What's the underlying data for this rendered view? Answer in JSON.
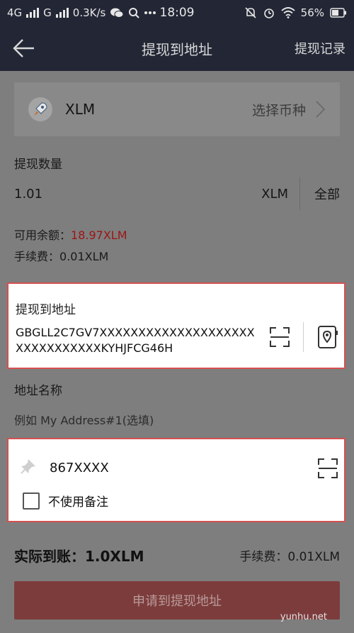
{
  "status_bar": {
    "network_1": "4G",
    "network_2": "G",
    "speed": "0.3K/s",
    "time": "18:09",
    "battery": "56%"
  },
  "nav": {
    "title": "提现到地址",
    "records": "提现记录"
  },
  "coin": {
    "name": "XLM",
    "select_label": "选择币种"
  },
  "amount": {
    "label": "提现数量",
    "value": "1.01",
    "unit": "XLM",
    "all_label": "全部"
  },
  "balance": {
    "label": "可用余额：",
    "value": "18.97XLM"
  },
  "fee": {
    "label": "手续费：",
    "value": "0.01XLM"
  },
  "address": {
    "label": "提现到地址",
    "value": "GBGLL2C7GV7XXXXXXXXXXXXXXXXXXXXXXXXXXXXXXXKYHJFCG46H"
  },
  "address_name": {
    "label": "地址名称",
    "placeholder": "例如 My Address#1(选填)"
  },
  "memo": {
    "value": "867XXXX",
    "no_memo_label": "不使用备注"
  },
  "summary": {
    "actual_label": "实际到账：",
    "actual_value": "1.0XLM",
    "fee_label": "手续费：",
    "fee_value": "0.01XLM"
  },
  "submit_label": "申请到提现地址",
  "watermark": "yunhu.net",
  "colors": {
    "header_bg": "#232735",
    "overlay_bg": "#7e7e7e",
    "highlight_border": "#d65050",
    "balance_red": "#9e1414",
    "submit_bg": "#7d3c3c"
  }
}
